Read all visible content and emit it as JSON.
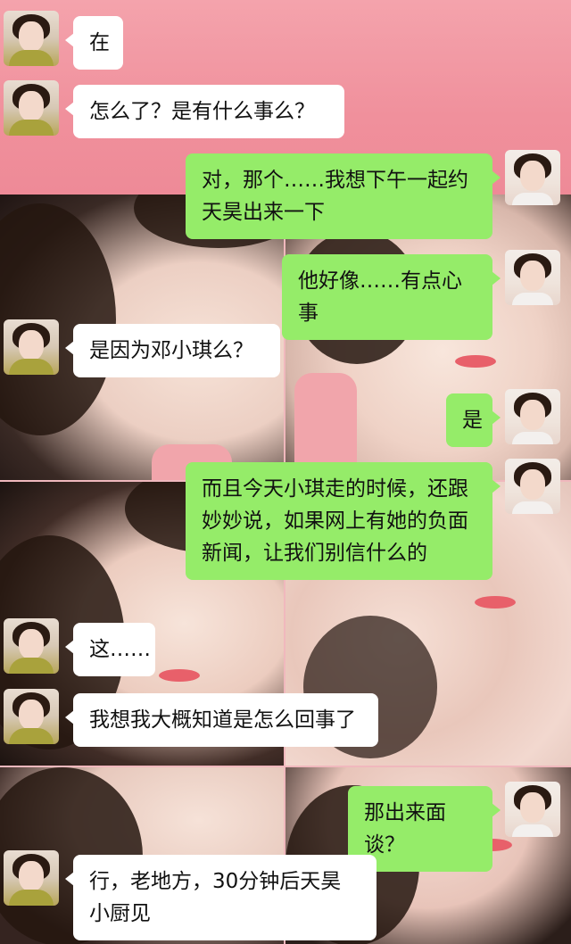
{
  "chat": {
    "messages": [
      {
        "side": "in",
        "text": "在"
      },
      {
        "side": "in",
        "text": "怎么了？是有什么事么？"
      },
      {
        "side": "out",
        "text": "对，那个……我想下午一起约天昊出来一下"
      },
      {
        "side": "out",
        "text": "他好像……有点心事"
      },
      {
        "side": "in",
        "text": "是因为邓小琪么？"
      },
      {
        "side": "out",
        "text": "是"
      },
      {
        "side": "out",
        "text": "而且今天小琪走的时候，还跟妙妙说，如果网上有她的负面新闻，让我们别信什么的"
      },
      {
        "side": "in",
        "text": "这……"
      },
      {
        "side": "in",
        "text": "我想我大概知道是怎么回事了"
      },
      {
        "side": "out",
        "text": "那出来面谈？"
      },
      {
        "side": "in",
        "text": "行，老地方，30分钟后天昊小厨见"
      }
    ]
  },
  "colors": {
    "incoming_bubble": "#ffffff",
    "outgoing_bubble": "#95ec69",
    "top_band": "#f0909c"
  },
  "icons": {
    "incoming_avatar": "girl-avatar-olive-shirt",
    "outgoing_avatar": "girl-avatar-white-shirt"
  }
}
